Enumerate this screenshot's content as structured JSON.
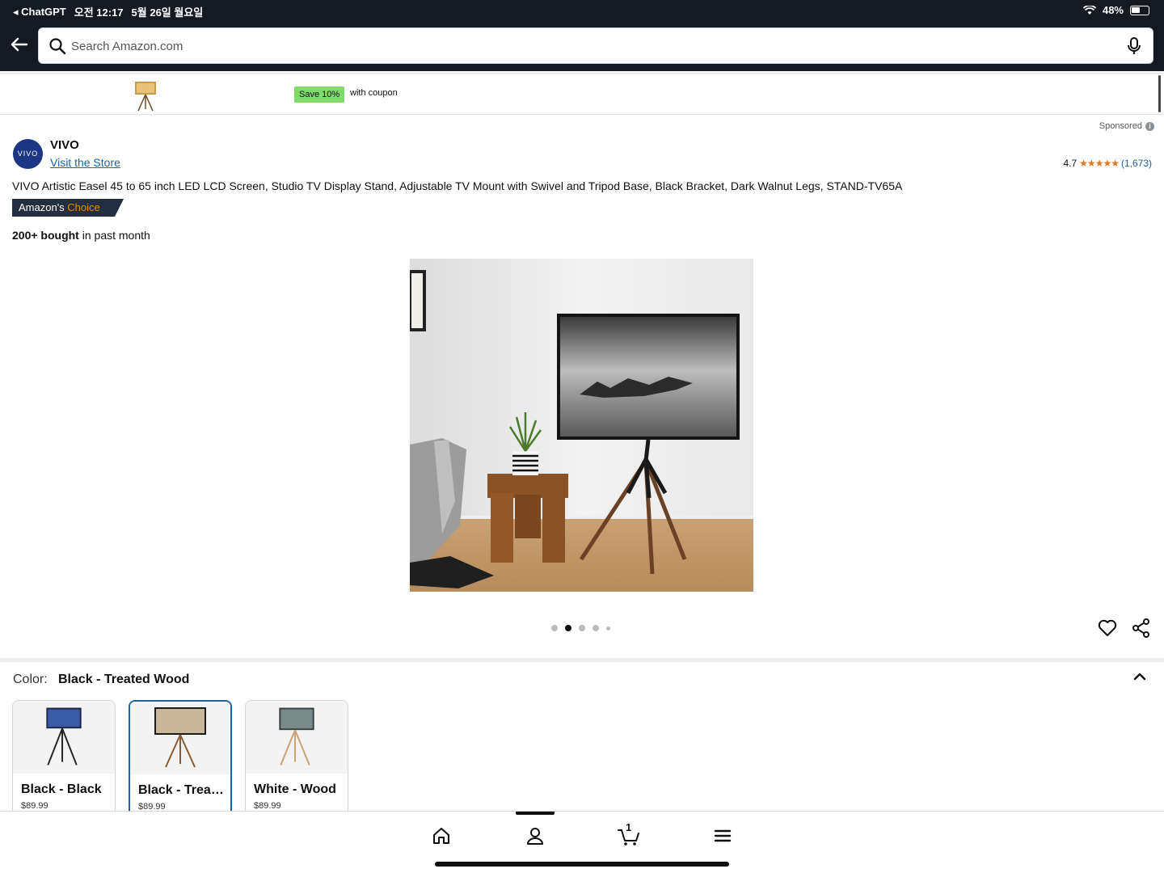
{
  "status_bar": {
    "back_app": "◂ ChatGPT",
    "time": "오전 12:17",
    "date": "5월 26일 월요일",
    "battery": "48%"
  },
  "search": {
    "placeholder": "Search Amazon.com"
  },
  "coupon": {
    "badge": "Save 10%",
    "text": "with coupon"
  },
  "sponsored_label": "Sponsored",
  "brand": {
    "logo_text": "VIVO",
    "name": "VIVO",
    "visit_store": "Visit the Store"
  },
  "rating": {
    "value": "4.7",
    "stars": "★★★★★",
    "count": "(1,673)"
  },
  "product": {
    "title": "VIVO Artistic Easel 45 to 65 inch LED LCD Screen, Studio TV Display Stand, Adjustable TV Mount with Swivel and Tripod Base, Black Bracket, Dark Walnut Legs, STAND-TV65A",
    "choice_prefix": "Amazon's",
    "choice_accent": "Choice",
    "bought_bold": "200+ bought",
    "bought_rest": " in past month"
  },
  "carousel": {
    "total_dots": 5,
    "active_index": 1
  },
  "color": {
    "label": "Color:",
    "value": "Black - Treated Wood"
  },
  "swatches": [
    {
      "label": "Black - Black",
      "price": "$89.99"
    },
    {
      "label": "Black - Treated Wood",
      "price": "$89.99"
    },
    {
      "label": "White - Wood",
      "price": "$89.99"
    }
  ],
  "bottom_nav": {
    "cart_count": "1"
  },
  "colors": {
    "header_bg": "#131a22",
    "link": "#2162a1",
    "star": "#de7921",
    "coupon_green": "#7fda69",
    "badge_bg": "#232f3e"
  }
}
